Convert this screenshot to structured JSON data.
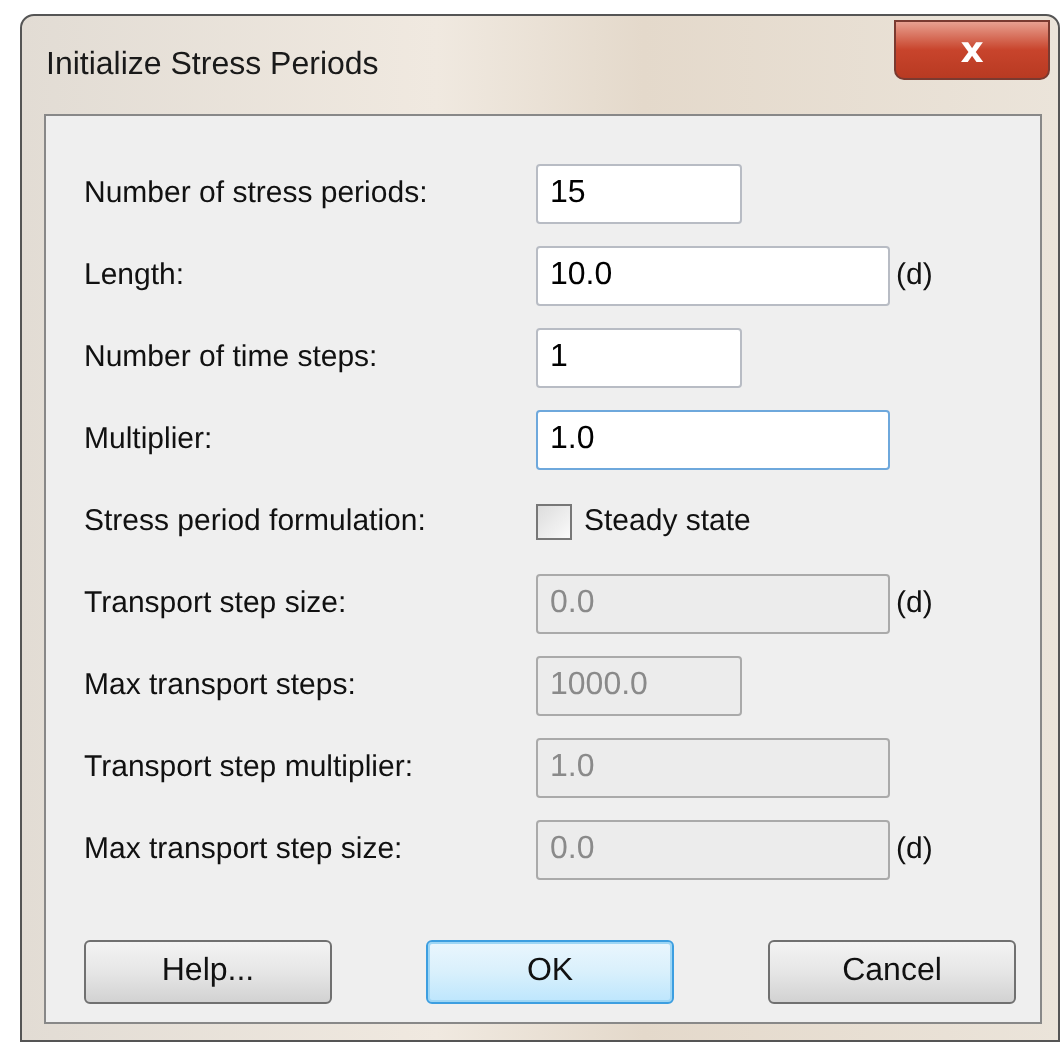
{
  "window": {
    "title": "Initialize Stress Periods",
    "close": "x"
  },
  "rows": [
    {
      "kind": "short_field",
      "label": "Number of stress periods:",
      "value": "15",
      "disabled": false,
      "focused": false
    },
    {
      "kind": "long_field",
      "label": "Length:",
      "value": "10.0",
      "disabled": false,
      "focused": false,
      "unit": "(d)"
    },
    {
      "kind": "short_field",
      "label": "Number of time steps:",
      "value": "1",
      "disabled": false,
      "focused": false
    },
    {
      "kind": "long_field",
      "label": "Multiplier:",
      "value": "1.0",
      "disabled": false,
      "focused": true
    },
    {
      "kind": "checkbox",
      "label": "Stress period formulation:",
      "text": "Steady state",
      "checked": false
    },
    {
      "kind": "long_field",
      "label": "Transport step size:",
      "value": "0.0",
      "disabled": true,
      "focused": false,
      "unit": "(d)"
    },
    {
      "kind": "short_field",
      "label": "Max transport steps:",
      "value": "1000.0",
      "disabled": true,
      "focused": false
    },
    {
      "kind": "long_field",
      "label": "Transport step multiplier:",
      "value": "1.0",
      "disabled": true,
      "focused": false
    },
    {
      "kind": "long_field",
      "label": "Max transport step size:",
      "value": "0.0",
      "disabled": true,
      "focused": false,
      "unit": "(d)"
    }
  ],
  "buttons": [
    {
      "label": "Help...",
      "default": false
    },
    {
      "label": "OK",
      "default": true
    },
    {
      "label": "Cancel",
      "default": false
    }
  ]
}
